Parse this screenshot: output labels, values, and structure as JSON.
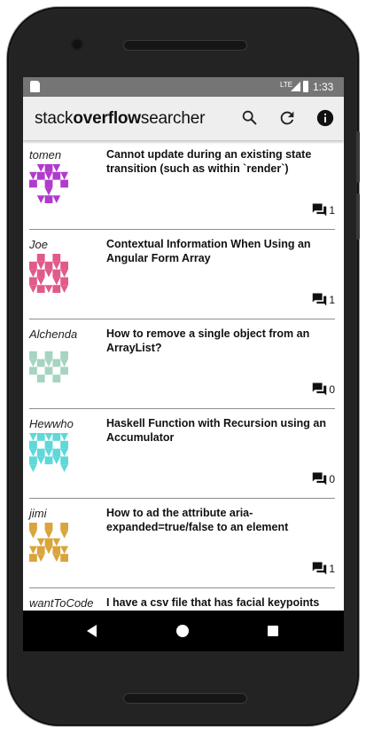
{
  "app": {
    "title_parts": [
      "stack",
      "overflow",
      "searcher"
    ]
  },
  "status_bar": {
    "network": "LTE",
    "time": "1:33"
  },
  "toolbar": {
    "icons": [
      "search-icon",
      "refresh-icon",
      "info-icon"
    ]
  },
  "questions": [
    {
      "author": "tomen",
      "title": "Cannot update during an existing state transition (such as within `render`)",
      "answer_count": "1",
      "avatar_color": "#b23acd"
    },
    {
      "author": "Joe",
      "title": "Contextual Information When Using an Angular Form Array",
      "answer_count": "1",
      "avatar_color": "#e05a8a"
    },
    {
      "author": "Alchenda",
      "title": "How to remove a single object from an ArrayList?",
      "answer_count": "0",
      "avatar_color": "#a6d4c0"
    },
    {
      "author": "Hewwho",
      "title": "Haskell Function with Recursion using an Accumulator",
      "answer_count": "0",
      "avatar_color": "#5ed8d8"
    },
    {
      "author": "jimi",
      "title": "How to ad the attribute aria-expanded=true/false to an element",
      "answer_count": "1",
      "avatar_color": "#d9a43a"
    },
    {
      "author": "wantToCode",
      "title": "I have a csv file that has facial keypoints and the image in the one dimensional ...",
      "answer_count": "",
      "avatar_color": "#8a8ad8"
    }
  ],
  "nav_bar": {
    "icons": [
      "back-icon",
      "home-icon",
      "recents-icon"
    ]
  }
}
